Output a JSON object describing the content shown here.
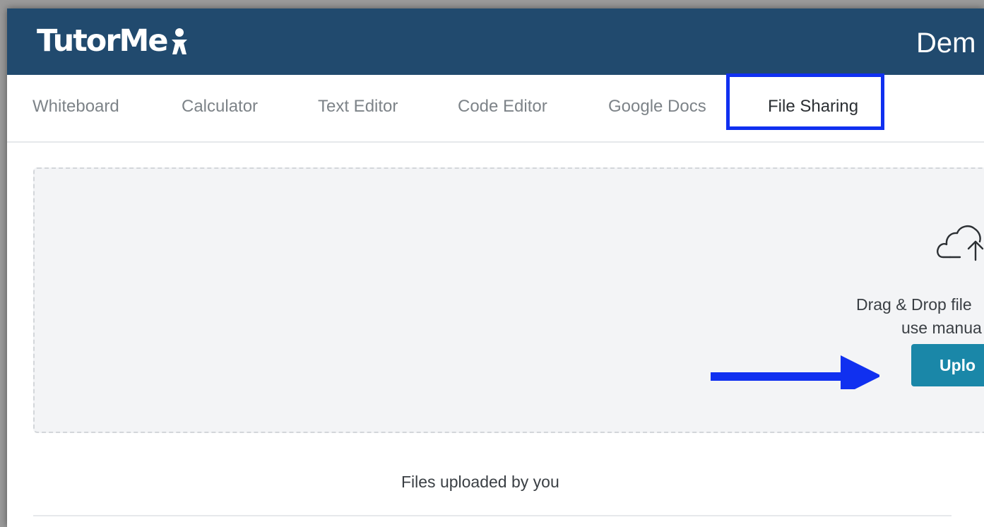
{
  "header": {
    "logo_text": "TutorMe",
    "right_text": "Dem"
  },
  "tabs": [
    {
      "label": "Whiteboard"
    },
    {
      "label": "Calculator"
    },
    {
      "label": "Text Editor"
    },
    {
      "label": "Code Editor"
    },
    {
      "label": "Google Docs"
    },
    {
      "label": "File Sharing",
      "active": true
    }
  ],
  "dropzone": {
    "line1": "Drag & Drop file",
    "line2": "use manua",
    "upload_label": "Uplo"
  },
  "files": {
    "heading": "Files uploaded by you"
  },
  "colors": {
    "header_bg": "#214a6e",
    "upload_button": "#1a87a8",
    "annotation_blue": "#1030f0"
  },
  "icons": [
    "person-logo-icon",
    "cloud-upload-icon",
    "arrow-right-annotation"
  ]
}
